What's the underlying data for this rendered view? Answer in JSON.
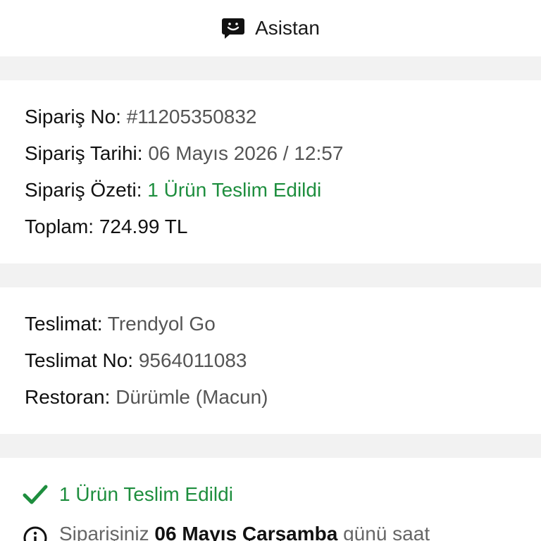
{
  "header": {
    "assistant_label": "Asistan",
    "assistant_icon": "chat-smile-icon"
  },
  "order": {
    "number_label": "Sipariş No:",
    "number_value": "#11205350832",
    "date_label": "Sipariş Tarihi:",
    "date_value": "06 Mayıs 2026 / 12:57",
    "summary_label": "Sipariş Özeti:",
    "summary_value": "1 Ürün Teslim Edildi",
    "total_label": "Toplam:",
    "total_value": "724.99 TL"
  },
  "delivery": {
    "method_label": "Teslimat:",
    "method_value": "Trendyol Go",
    "number_label": "Teslimat No:",
    "number_value": "9564011083",
    "restaurant_label": "Restoran:",
    "restaurant_value": "Dürümle (Macun)"
  },
  "status": {
    "title": "1 Ürün Teslim Edildi",
    "info_prefix": "Siparişiniz ",
    "info_date": "06 Mayıs Çarşamba",
    "info_suffix": " günü saat"
  },
  "colors": {
    "accent_green": "#1e8e3e",
    "background": "#f2f2f2",
    "card": "#ffffff"
  }
}
